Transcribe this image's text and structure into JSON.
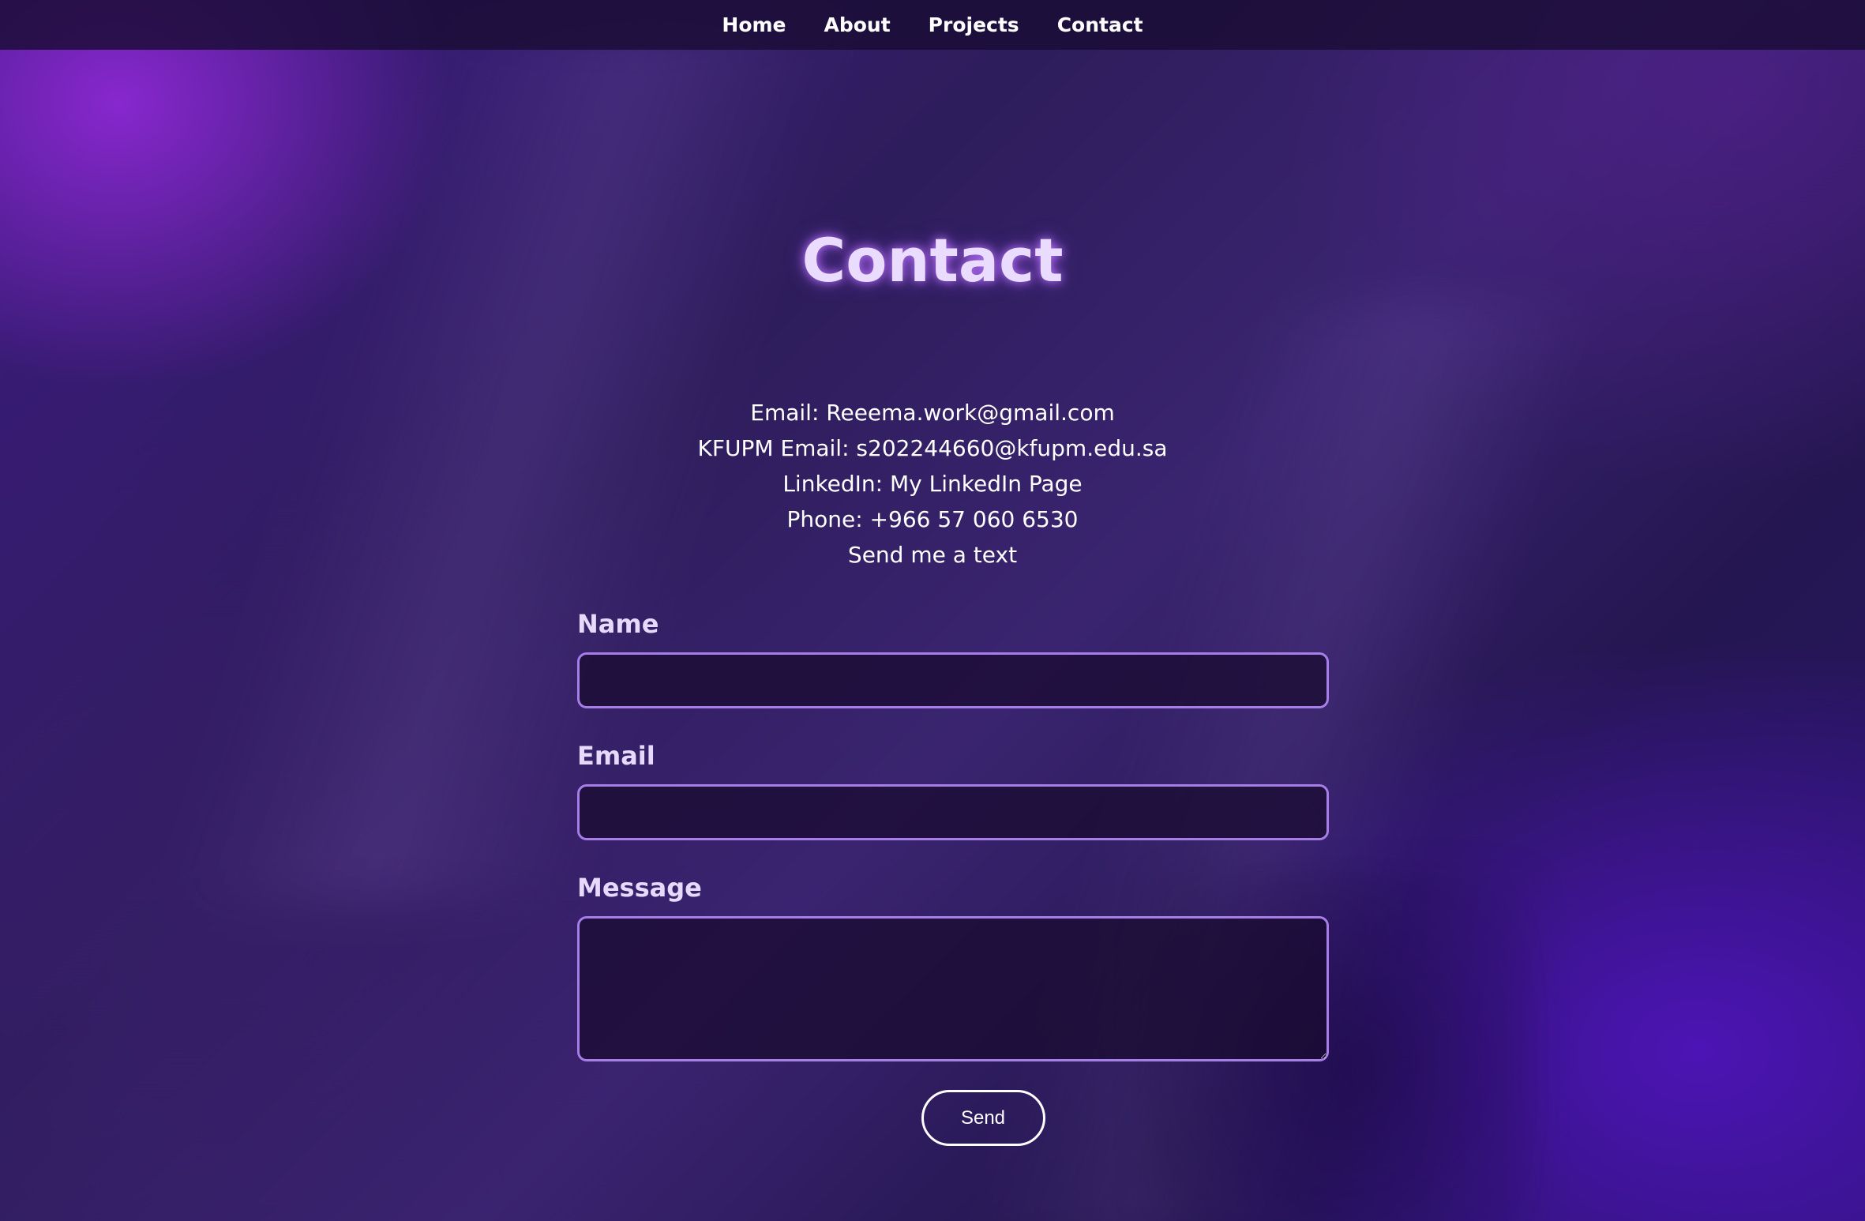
{
  "nav": {
    "items": [
      "Home",
      "About",
      "Projects",
      "Contact"
    ]
  },
  "page": {
    "title": "Contact"
  },
  "contact_info": {
    "email": "Email: Reeema.work@gmail.com",
    "kfupm_email": "KFUPM Email: s202244660@kfupm.edu.sa",
    "linkedin_prefix": "LinkedIn: ",
    "linkedin_link": "My LinkedIn Page",
    "phone": "Phone: +966 57 060 6530",
    "text_link": "Send me a text"
  },
  "form": {
    "name_label": "Name",
    "name_value": "",
    "email_label": "Email",
    "email_value": "",
    "message_label": "Message",
    "message_value": "",
    "send_label": "Send"
  },
  "colors": {
    "accent_border": "#a77de8",
    "title": "#eadcff",
    "label": "#e6d9fb",
    "nav_bg": "#1a0c34"
  }
}
